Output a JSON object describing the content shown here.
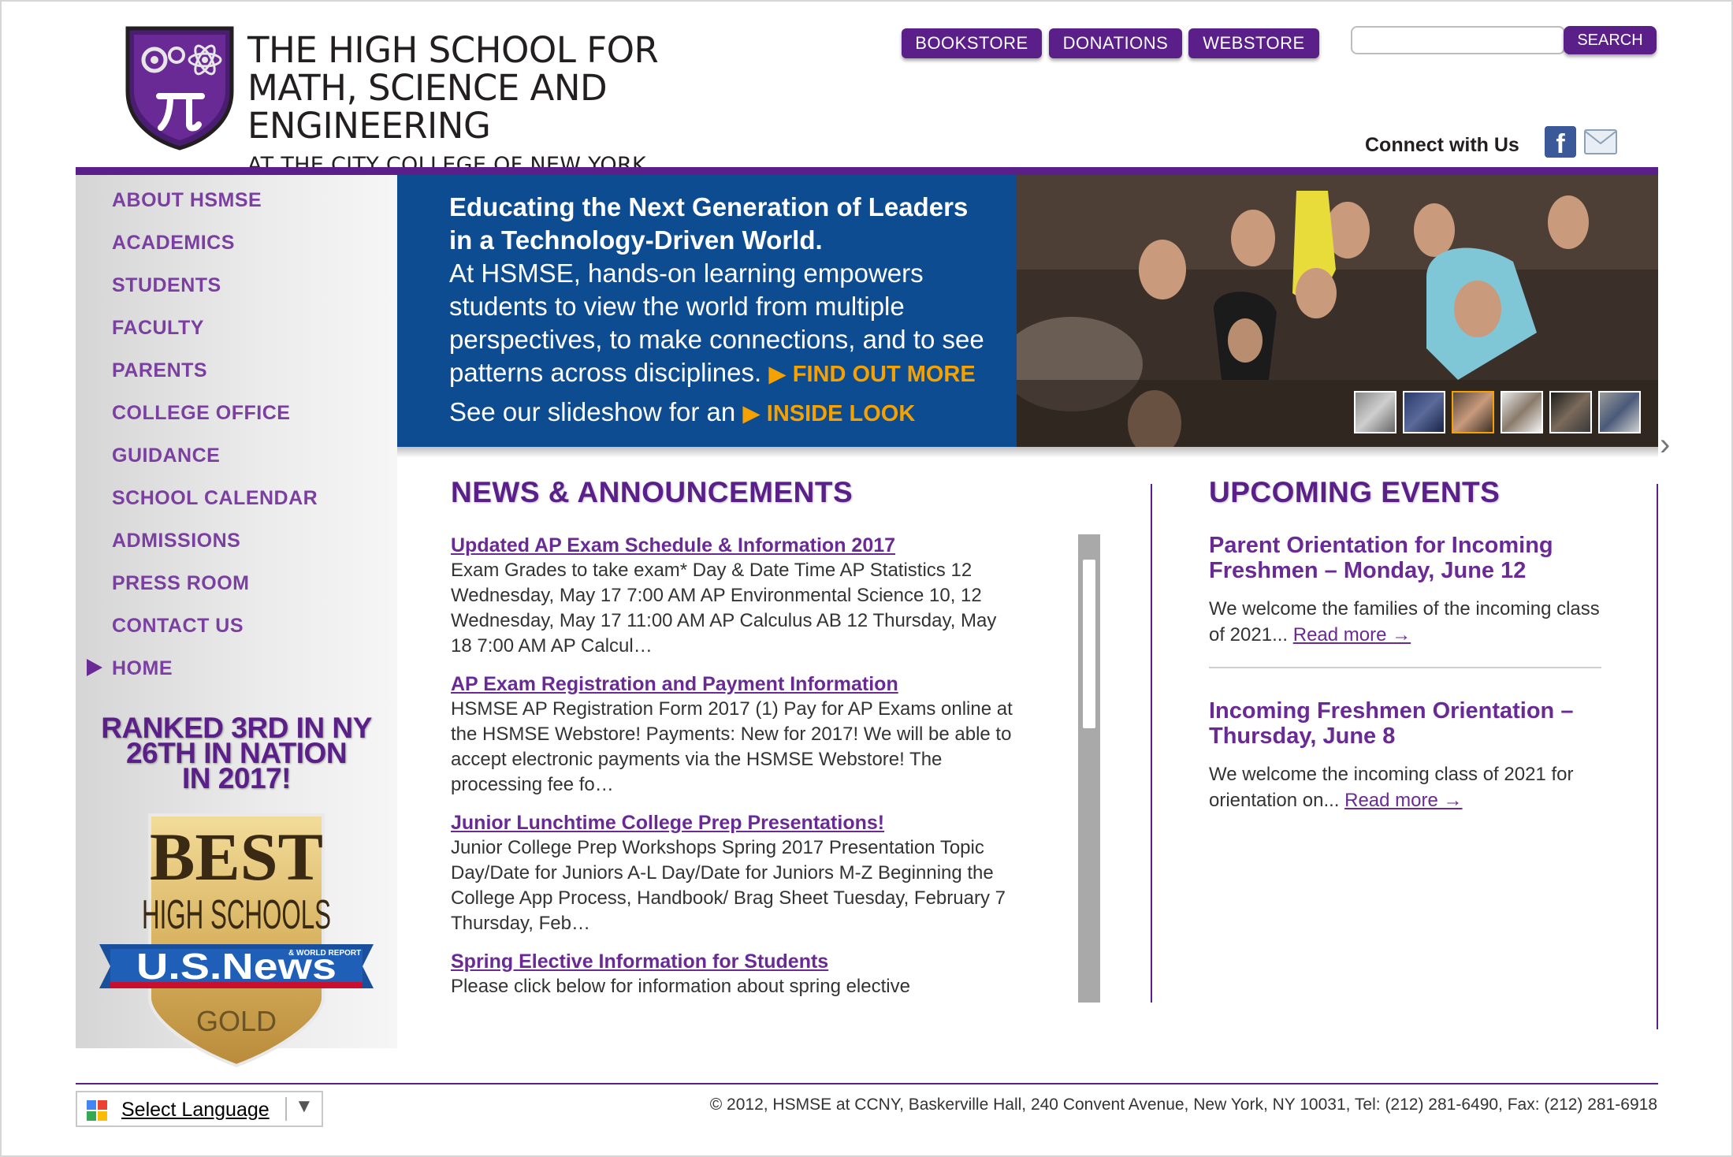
{
  "header": {
    "name_line1": "The High School for",
    "name_line2": "Math, Science and Engineering",
    "name_line3": "AT THE CITY COLLEGE OF NEW YORK",
    "top_buttons": [
      "BOOKSTORE",
      "DONATIONS",
      "WEBSTORE"
    ],
    "search": {
      "button_label": "SEARCH",
      "value": ""
    },
    "connect_label": "Connect with Us",
    "facebook_glyph": "f"
  },
  "sidebar": {
    "items": [
      {
        "label": "ABOUT HSMSE"
      },
      {
        "label": "ACADEMICS"
      },
      {
        "label": "STUDENTS"
      },
      {
        "label": "FACULTY"
      },
      {
        "label": "PARENTS"
      },
      {
        "label": "COLLEGE OFFICE"
      },
      {
        "label": "GUIDANCE"
      },
      {
        "label": "SCHOOL CALENDAR"
      },
      {
        "label": "ADMISSIONS"
      },
      {
        "label": "PRESS ROOM"
      },
      {
        "label": "CONTACT US"
      },
      {
        "label": "HOME",
        "active": true
      }
    ],
    "ranked_line1": "RANKED 3RD IN NY",
    "ranked_line2": "26TH IN NATION",
    "ranked_line3": "IN 2017!",
    "badge": {
      "best": "BEST",
      "high_schools": "HIGH SCHOOLS",
      "world_report": "& WORLD REPORT",
      "usnews": "U.S.News",
      "gold": "GOLD"
    }
  },
  "hero": {
    "heading_line1": "Educating the Next Generation of Leaders",
    "heading_line2": "in a Technology-Driven World.",
    "body": "At HSMSE, hands-on learning empowers students to view the world from multiple perspectives, to make connections, and to see patterns across disciplines.",
    "find_out_more": "FIND OUT MORE",
    "slideshow_text": "See our slideshow for an",
    "inside_look": "INSIDE LOOK",
    "thumbnail_count": 6,
    "active_thumbnail": 3
  },
  "news": {
    "title": "NEWS & ANNOUNCEMENTS",
    "items": [
      {
        "title": "Updated AP Exam Schedule & Information 2017",
        "excerpt": "Exam Grades to take exam* Day & Date Time AP Statistics 12 Wednesday, May 17 7:00 AM AP Environmental Science 10, 12 Wednesday, May 17 11:00 AM AP Calculus AB 12 Thursday, May 18 7:00 AM AP Calcul…"
      },
      {
        "title": "AP Exam Registration and Payment Information",
        "excerpt": "HSMSE AP Registration Form 2017 (1)  Pay for AP Exams online at the HSMSE Webstore! Payments: New for 2017! We will be able to accept electronic payments via the HSMSE Webstore! The processing fee fo…"
      },
      {
        "title": "Junior Lunchtime College Prep Presentations!",
        "excerpt": "Junior College Prep Workshops Spring 2017 Presentation Topic Day/Date for Juniors A-L Day/Date for Juniors M-Z Beginning the College App Process, Handbook/ Brag Sheet Tuesday, February 7 Thursday, Feb…"
      },
      {
        "title": "Spring Elective Information for Students",
        "excerpt": "Please click below for information about spring elective"
      }
    ]
  },
  "events": {
    "title": "UPCOMING EVENTS",
    "items": [
      {
        "title": "Parent Orientation for Incoming Freshmen – Monday, June 12",
        "desc": "We welcome the families of the incoming class of 2021...",
        "read_more": "Read more →"
      },
      {
        "title": "Incoming Freshmen Orientation – Thursday, June 8",
        "desc": "We welcome the incoming class of 2021 for orientation on...",
        "read_more": "Read more →"
      }
    ]
  },
  "footer": {
    "language_label": "Select Language",
    "language_arrow": "▼",
    "copyright": "© 2012, HSMSE at CCNY, Baskerville Hall, 240 Convent Avenue, New York, NY 10031, Tel: (212) 281-6490, Fax: (212) 281-6918"
  },
  "colors": {
    "brand_purple": "#5b1f8a",
    "nav_purple": "#7b3fa2",
    "hero_blue": "#0e4c92",
    "accent_orange": "#f5a200"
  },
  "icons": [
    "logo-shield-icon",
    "facebook-icon",
    "email-icon",
    "play-arrow-icon",
    "chevron-right-icon",
    "google-translate-icon",
    "dropdown-arrow-icon"
  ]
}
